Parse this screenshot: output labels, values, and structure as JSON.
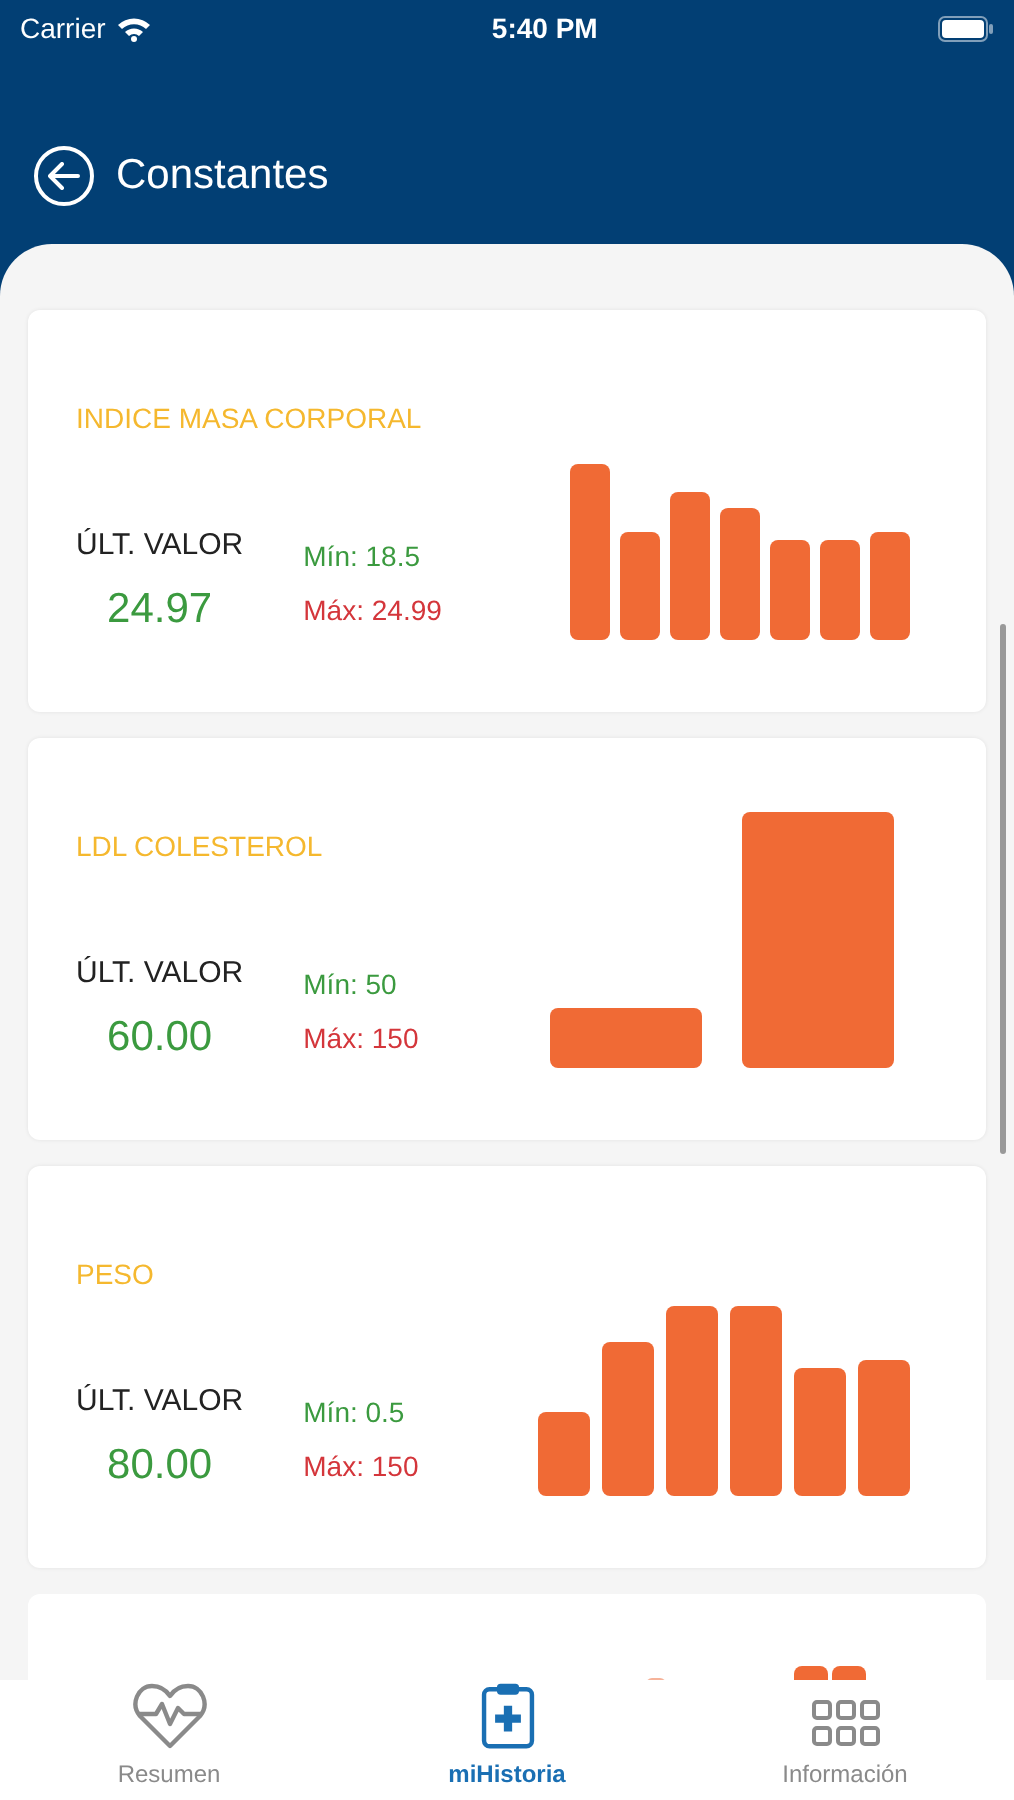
{
  "status_bar": {
    "carrier": "Carrier",
    "time": "5:40 PM"
  },
  "header": {
    "title": "Constantes"
  },
  "cards": [
    {
      "title": "INDICE MASA CORPORAL",
      "last_value_label": "ÚLT. VALOR",
      "last_value": "24.97",
      "min": "Mín: 18.5",
      "max": "Máx: 24.99"
    },
    {
      "title": "LDL COLESTEROL",
      "last_value_label": "ÚLT. VALOR",
      "last_value": "60.00",
      "min": "Mín: 50",
      "max": "Máx: 150"
    },
    {
      "title": "PESO",
      "last_value_label": "ÚLT. VALOR",
      "last_value": "80.00",
      "min": "Mín: 0.5",
      "max": "Máx: 150"
    }
  ],
  "tabs": [
    {
      "label": "Resumen",
      "selected": false,
      "kind": "heart"
    },
    {
      "label": "miHistoria",
      "selected": true,
      "kind": "clipboard"
    },
    {
      "label": "Información",
      "selected": false,
      "kind": "grid"
    }
  ]
}
